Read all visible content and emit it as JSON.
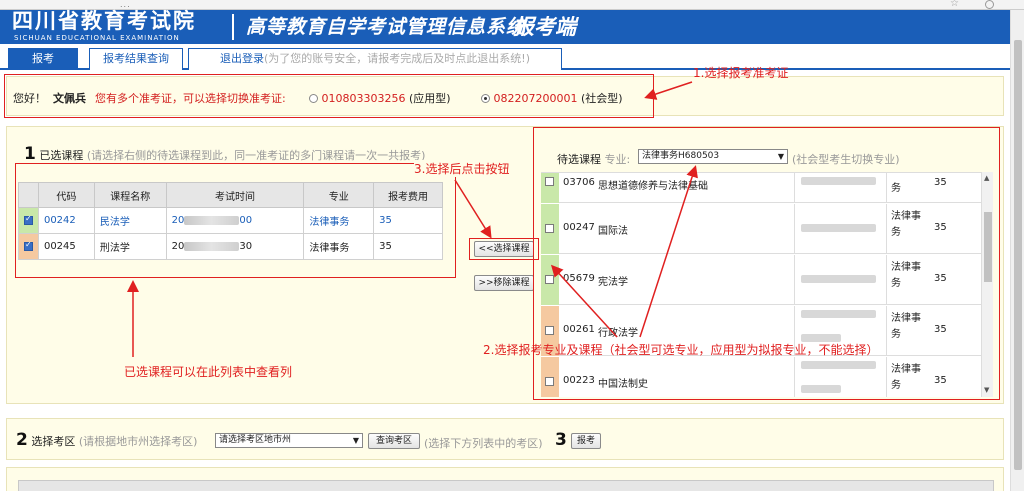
{
  "browser": {
    "url": "..."
  },
  "header": {
    "logo": "四川省教育考试院",
    "logo_en": "SICHUAN EDUCATIONAL EXAMINATION",
    "system_title": "高等教育自学考试管理信息系统",
    "system_end": "报考端"
  },
  "tabs": [
    {
      "label": "报考"
    },
    {
      "label": "报考结果查询"
    },
    {
      "label": "退出登录",
      "hint": "(为了您的账号安全，请报考完成后及时点此退出系统!)"
    }
  ],
  "info": {
    "greeting": "您好！",
    "name": "文佩兵",
    "multi_notice": "您有多个准考证，可以选择切换准考证:",
    "options": [
      {
        "number": "010803303256",
        "type": "(应用型)",
        "selected": false
      },
      {
        "number": "082207200001",
        "type": "(社会型)",
        "selected": true
      }
    ]
  },
  "selected_section": {
    "step": "1",
    "title": "已选课程",
    "hint": "(请选择右侧的待选课程到此，同一准考证的多门课程请一次一共报考)",
    "columns": [
      "代码",
      "课程名称",
      "考试时间",
      "专业",
      "报考费用"
    ],
    "rows": [
      {
        "checked": true,
        "code": "00242",
        "name": "民法学",
        "time_prefix": "20",
        "time_suffix": "00",
        "major": "法律事务",
        "fee": "35"
      },
      {
        "checked": true,
        "code": "00245",
        "name": "刑法学",
        "time_prefix": "20",
        "time_suffix": "30",
        "major": "法律事务",
        "fee": "35"
      }
    ]
  },
  "buttons": {
    "select_course": "<<选择课程",
    "remove_course": ">>移除课程"
  },
  "pending_section": {
    "title": "待选课程",
    "major_label": "专业:",
    "major_value": "法律事务H680503",
    "hint": "(社会型考生切换专业)",
    "rows": [
      {
        "checked": false,
        "code": "03706",
        "name": "思想道德修养与法律基础",
        "major": "务",
        "fee": "35",
        "color": "#c9e8a9"
      },
      {
        "checked": false,
        "code": "00247",
        "name": "国际法",
        "major": "法律事务",
        "fee": "35",
        "color": "#c9e8a9"
      },
      {
        "checked": false,
        "code": "05679",
        "name": "宪法学",
        "major": "法律事务",
        "fee": "35",
        "color": "#c9e8a9"
      },
      {
        "checked": false,
        "code": "00261",
        "name": "行政法学",
        "major": "法律事务",
        "fee": "35",
        "color": "#f5c9a0"
      },
      {
        "checked": false,
        "code": "00223",
        "name": "中国法制史",
        "major": "法律事务",
        "fee": "35",
        "color": "#f5c9a0"
      }
    ]
  },
  "region_section": {
    "step2": "2",
    "title": "选择考区",
    "hint": "(请根据地市州选择考区)",
    "select_placeholder": "请选择考区地市州",
    "query_btn": "查询考区",
    "hint2": "(选择下方列表中的考区)",
    "step3": "3",
    "submit_btn": "报考"
  },
  "annotations": {
    "a1": "1.选择报考准考证",
    "a2": "2.选择报考专业及课程（社会型可选专业，应用型为拟报专业，不能选择）",
    "a3": "3.选择后点击按钮",
    "a4": "已选课程可以在此列表中查看列"
  },
  "colors": {
    "brand_blue": "#1a5eb8",
    "annotation_red": "#e02020",
    "panel_bg": "#fffde8"
  }
}
